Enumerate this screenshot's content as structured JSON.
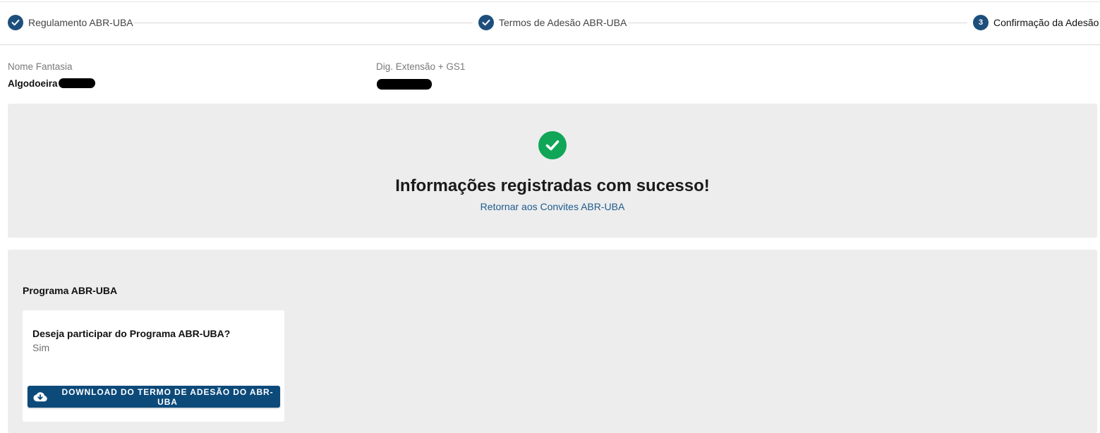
{
  "stepper": {
    "steps": [
      {
        "label": "Regulamento ABR-UBA",
        "state": "completed"
      },
      {
        "label": "Termos de Adesão ABR-UBA",
        "state": "completed"
      },
      {
        "label": "Confirmação da Adesão",
        "state": "active",
        "number": "3"
      }
    ]
  },
  "company": {
    "name_label": "Nome Fantasia",
    "name_value": "Algodoeira",
    "gs1_label": "Dig. Extensão + GS1"
  },
  "success": {
    "title": "Informações registradas com sucesso!",
    "return_link": "Retornar aos Convites ABR-UBA"
  },
  "program": {
    "title": "Programa ABR-UBA",
    "question": "Deseja participar do Programa ABR-UBA?",
    "answer": "Sim",
    "download_label": "DOWNLOAD DO TERMO DE ADESÃO DO ABR-UBA"
  },
  "colors": {
    "primary": "#1d4f7c",
    "success": "#0fa657",
    "button": "#0c4a7a",
    "panel": "#ededed"
  },
  "icons": [
    "check-icon",
    "check-circle-icon",
    "cloud-download-icon"
  ]
}
